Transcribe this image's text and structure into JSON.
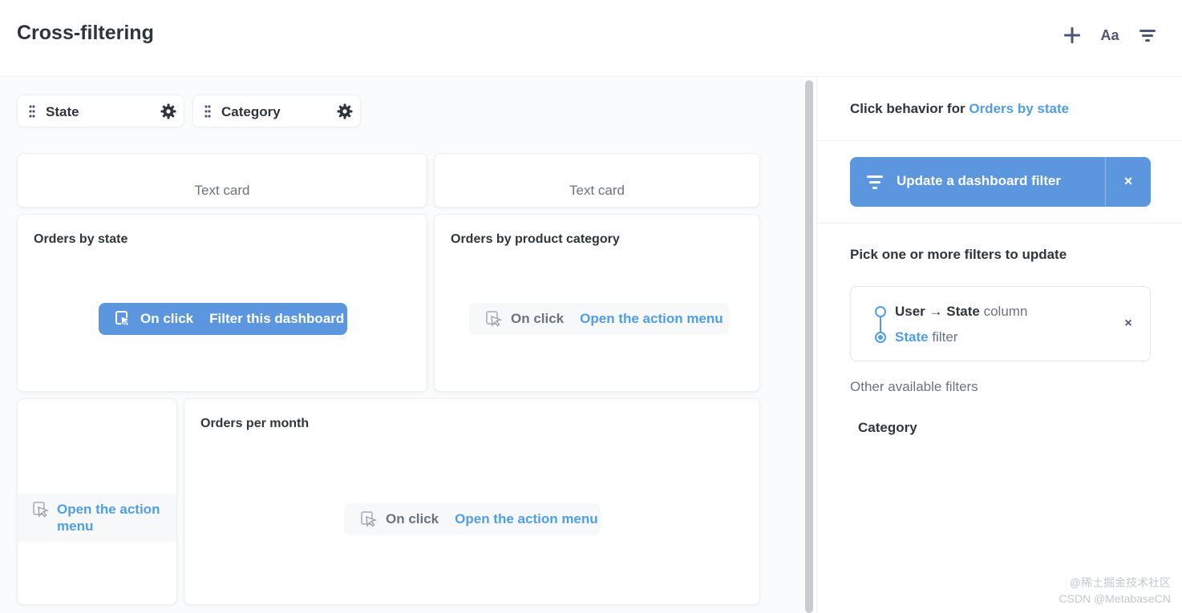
{
  "header": {
    "title": "Cross-filtering",
    "font_button_label": "Aa"
  },
  "filters": [
    {
      "label": "State"
    },
    {
      "label": "Category"
    }
  ],
  "cards": {
    "text_card_1": "Text card",
    "text_card_2": "Text card",
    "orders_by_state": {
      "title": "Orders by state",
      "on_click": "On click",
      "action": "Filter this dashboard"
    },
    "orders_by_category": {
      "title": "Orders by product category",
      "on_click": "On click",
      "action": "Open the action menu"
    },
    "small_card": {
      "action": "Open the action menu"
    },
    "orders_per_month": {
      "title": "Orders per month",
      "on_click": "On click",
      "action": "Open the action menu"
    }
  },
  "sidebar": {
    "heading_prefix": "Click behavior for",
    "heading_link": "Orders by state",
    "update_button": "Update a dashboard filter",
    "close_symbol": "×",
    "pick_heading": "Pick one or more filters to update",
    "mapping": {
      "source_table": "User",
      "arrow": "→",
      "source_column": "State",
      "source_suffix": "column",
      "target_filter": "State",
      "target_suffix": "filter"
    },
    "other_label": "Other available filters",
    "other_items": [
      "Category"
    ]
  },
  "watermark": {
    "line1": "@稀土掘金技术社区",
    "line2": "CSDN @MetabaseCN"
  },
  "colors": {
    "accent": "#509ee3",
    "accent_button": "#5b96de",
    "text_dark": "#2e353b",
    "text_muted": "#6b7280",
    "canvas_bg": "#f9fbfc"
  },
  "icons": [
    "plus-icon",
    "font-icon",
    "filter-icon",
    "grip-icon",
    "gear-icon",
    "cursor-click-icon",
    "close-icon"
  ]
}
